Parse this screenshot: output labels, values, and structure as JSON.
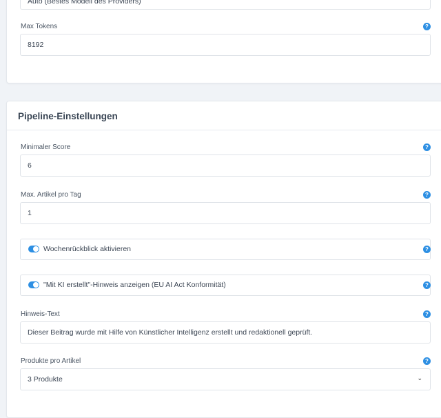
{
  "model_card": {
    "model_select_value": "Auto (Bestes Modell des Providers)",
    "max_tokens_label": "Max Tokens",
    "max_tokens_value": "8192"
  },
  "pipeline": {
    "title": "Pipeline-Einstellungen",
    "min_score_label": "Minimaler Score",
    "min_score_value": "6",
    "max_articles_label": "Max. Artikel pro Tag",
    "max_articles_value": "1",
    "weekly_review_label": "Wochenrückblick aktivieren",
    "weekly_review_enabled": true,
    "ai_notice_label": "\"Mit KI erstellt\"-Hinweis anzeigen (EU AI Act Konformität)",
    "ai_notice_enabled": true,
    "notice_text_label": "Hinweis-Text",
    "notice_text_value": "Dieser Beitrag wurde mit Hilfe von Künstlicher Intelligenz erstellt und redaktionell geprüft.",
    "products_label": "Produkte pro Artikel",
    "products_value": "3 Produkte"
  },
  "icons": {
    "help": "?",
    "chevron": "⌄"
  },
  "colors": {
    "accent": "#2d8fe3",
    "background": "#f0f3f7"
  }
}
